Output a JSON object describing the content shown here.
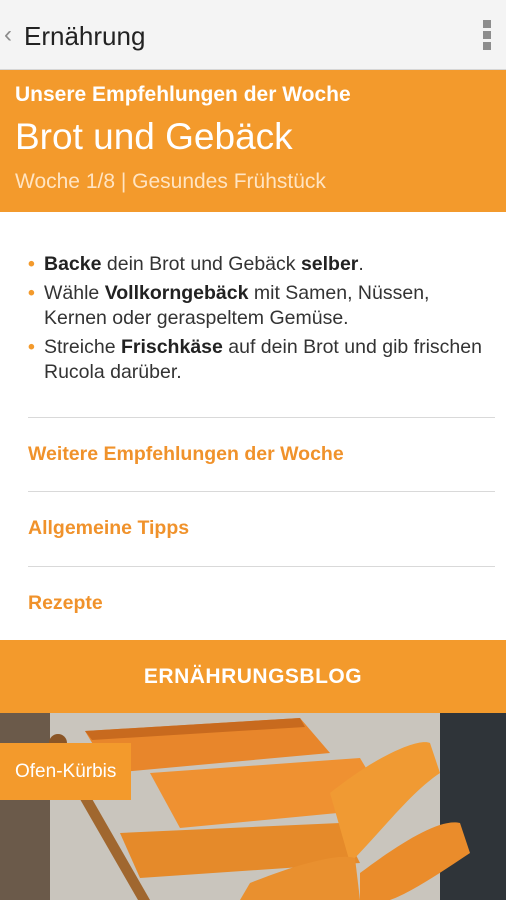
{
  "appbar": {
    "back_glyph": "‹",
    "title": "Ernährung",
    "menu_icon": "overflow-menu-icon"
  },
  "hero": {
    "subtitle": "Unsere Empfehlungen der Woche",
    "title": "Brot und Gebäck",
    "week": "Woche 1/8 | Gesundes Frühstück"
  },
  "tips": [
    {
      "parts": [
        {
          "b": "Backe"
        },
        {
          "t": " dein Brot und Gebäck "
        },
        {
          "b": "selber"
        },
        {
          "t": "."
        }
      ]
    },
    {
      "parts": [
        {
          "t": "Wähle "
        },
        {
          "b": "Vollkorngebäck"
        },
        {
          "t": " mit Samen, Nüssen, Kernen oder geraspeltem Gemüse."
        }
      ]
    },
    {
      "parts": [
        {
          "t": "Streiche "
        },
        {
          "b": "Frischkäse"
        },
        {
          "t": " auf dein Brot und gib frischen Rucola darüber."
        }
      ]
    }
  ],
  "links": {
    "more": "Weitere Empfehlungen der Woche",
    "general": "Allgemeine Tipps",
    "recipes": "Rezepte"
  },
  "blog_button": "ERNÄHRUNGSBLOG",
  "photo_caption": "Ofen-Kürbis",
  "colors": {
    "accent": "#f39a2c",
    "link": "#f0922b",
    "appbar": "#f4f4f4"
  }
}
